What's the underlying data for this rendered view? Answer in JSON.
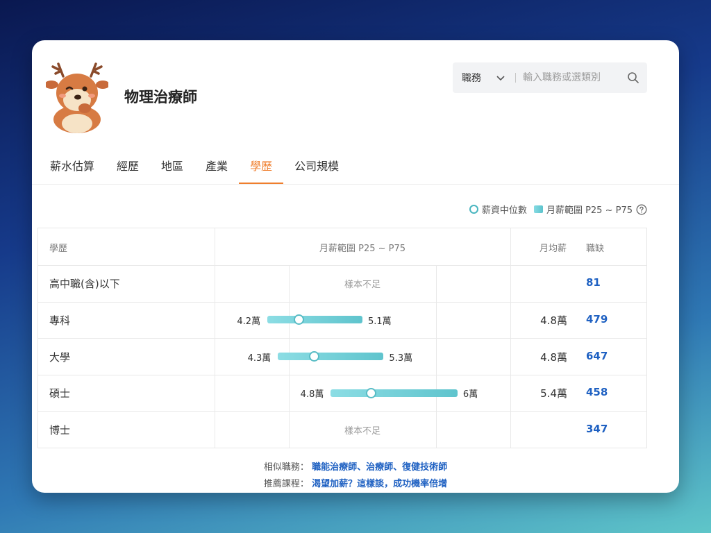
{
  "header": {
    "job_title": "物理治療師"
  },
  "search": {
    "category_label": "職務",
    "placeholder": "輸入職務或選類別"
  },
  "tabs": [
    {
      "label": "薪水估算",
      "active": false
    },
    {
      "label": "經歷",
      "active": false
    },
    {
      "label": "地區",
      "active": false
    },
    {
      "label": "產業",
      "active": false
    },
    {
      "label": "學歷",
      "active": true
    },
    {
      "label": "公司規模",
      "active": false
    }
  ],
  "legend": {
    "median_label": "薪資中位數",
    "range_label": "月薪範圍 P25 ~ P75"
  },
  "table": {
    "headers": {
      "education": "學歷",
      "range": "月薪範圍 P25 ~ P75",
      "average": "月均薪",
      "vacancies": "職缺"
    },
    "axis_min": 3.7,
    "axis_max": 6.5,
    "rows": [
      {
        "education": "高中職(含)以下",
        "insufficient": "樣本不足",
        "vacancies": "81"
      },
      {
        "education": "專科",
        "p25": 4.2,
        "median": 4.5,
        "p75": 5.1,
        "p25_label": "4.2萬",
        "p75_label": "5.1萬",
        "average": "4.8萬",
        "vacancies": "479"
      },
      {
        "education": "大學",
        "p25": 4.3,
        "median": 4.64,
        "p75": 5.3,
        "p25_label": "4.3萬",
        "p75_label": "5.3萬",
        "average": "4.8萬",
        "vacancies": "647"
      },
      {
        "education": "碩士",
        "p25": 4.8,
        "median": 5.18,
        "p75": 6.0,
        "p25_label": "4.8萬",
        "p75_label": "6萬",
        "average": "5.4萬",
        "vacancies": "458"
      },
      {
        "education": "博士",
        "insufficient": "樣本不足",
        "vacancies": "347"
      }
    ]
  },
  "footer": {
    "similar_label": "相似職務：",
    "similar_links": "職能治療師、治療師、復健技術師",
    "course_label": "推薦課程：",
    "course_link": "渴望加薪？這樣談，成功機率倍增"
  },
  "colors": {
    "accent": "#ef7e2d",
    "link": "#1f61c2",
    "bar_start": "#8cdde4",
    "bar_end": "#5fc4cd"
  },
  "icons": {
    "avatar": "deer-mascot-icon",
    "dropdown": "chevron-down-icon",
    "search": "search-icon",
    "help": "question-circle-icon"
  }
}
